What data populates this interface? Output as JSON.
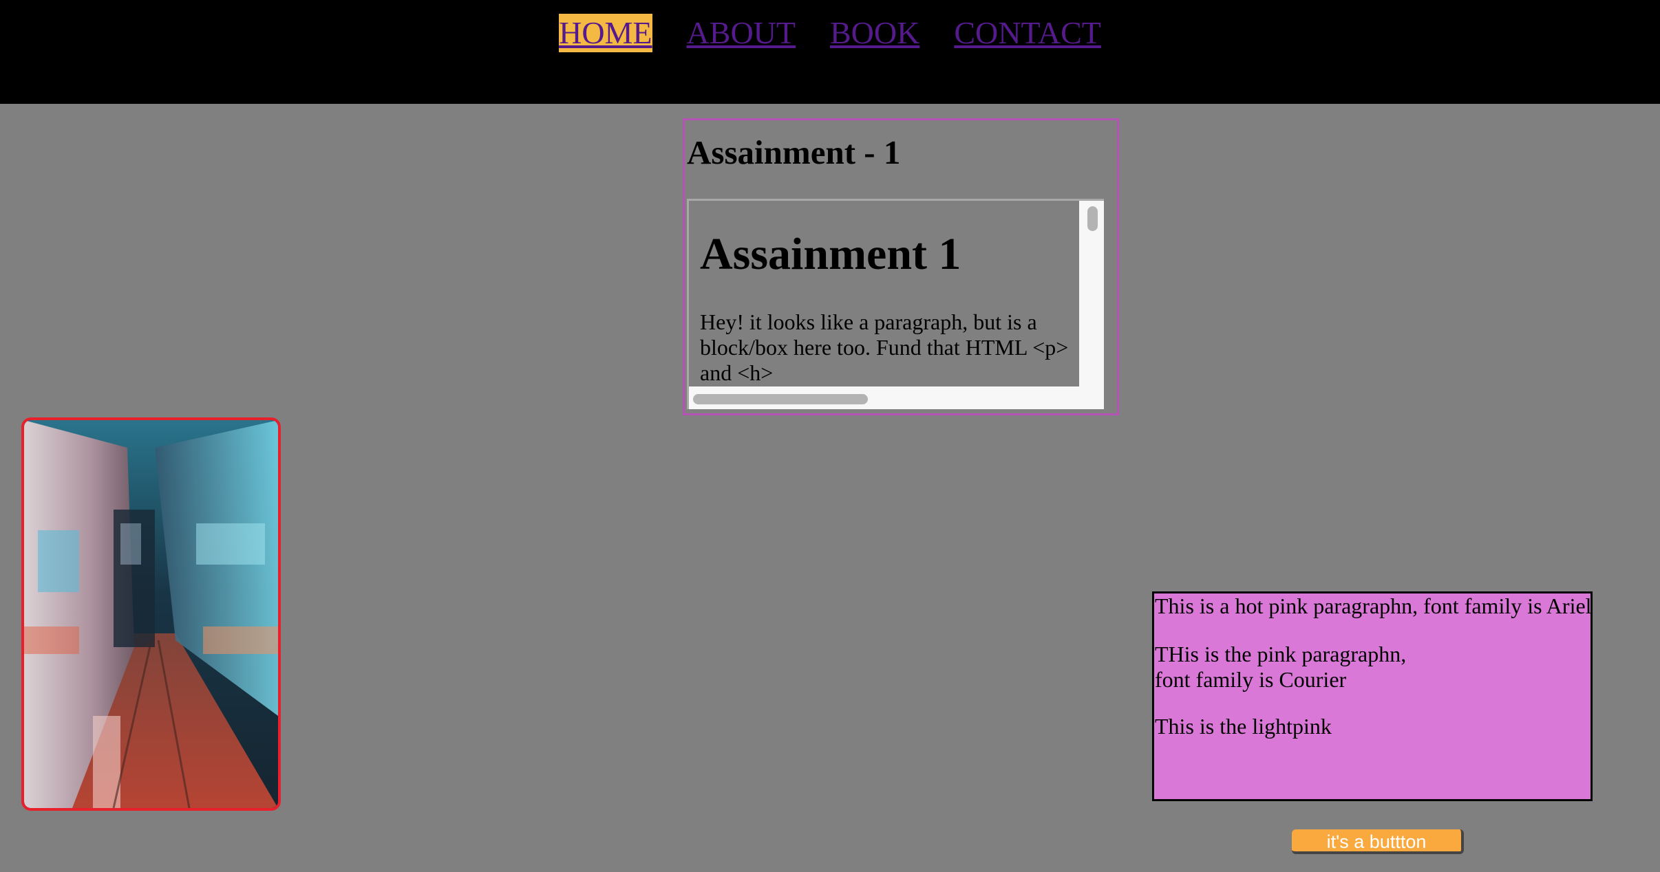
{
  "nav": {
    "items": [
      {
        "label": "HOME",
        "active": true
      },
      {
        "label": "ABOUT",
        "active": false
      },
      {
        "label": "BOOK",
        "active": false
      },
      {
        "label": "CONTACT",
        "active": false
      }
    ]
  },
  "assignment": {
    "title": "Assainment - 1",
    "frame": {
      "heading": "Assainment 1",
      "paragraph": "Hey! it looks like a paragraph, but is a block/box here too. Fund that HTML <p> and <h>"
    }
  },
  "image": {
    "subject": "motion-blurred city street at night",
    "border_color": "#e8202b"
  },
  "pink_box": {
    "paragraph1": "This is a hot pink paragraphn, font family is Ariel",
    "paragraph2_line1": "THis is the pink paragraphn,",
    "paragraph2_line2": "font family is Courier",
    "paragraph3": "This is the lightpink"
  },
  "button": {
    "label": "it's a buttton"
  },
  "colors": {
    "page_bg": "#808080",
    "topbar_bg": "#000000",
    "nav_link": "#551a8b",
    "nav_active_bg": "#f4b942",
    "frame_border": "#b552b5",
    "pink_box_bg": "#da78d8",
    "button_bg": "#f9a93d"
  }
}
